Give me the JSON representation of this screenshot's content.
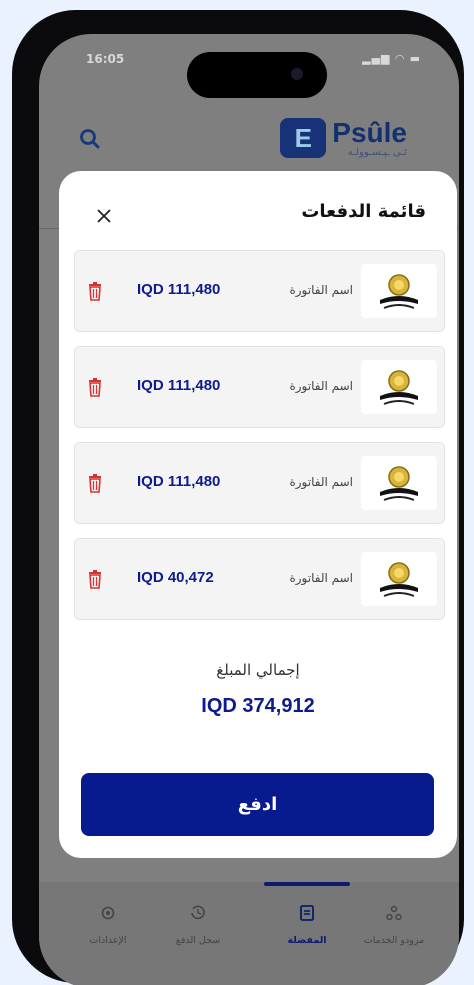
{
  "status_bar": {
    "time": "16:05",
    "icons": "signal-wifi-battery"
  },
  "header": {
    "logo_name": "Psûle",
    "logo_subtitle": "ئـی ـپـسـوولـه"
  },
  "modal": {
    "title": "قائمة الدفعات",
    "items": [
      {
        "name": "اسم الفاتورة",
        "amount": "IQD 111,480"
      },
      {
        "name": "اسم الفاتورة",
        "amount": "IQD 111,480"
      },
      {
        "name": "اسم الفاتورة",
        "amount": "IQD 111,480"
      },
      {
        "name": "اسم الفاتورة",
        "amount": "IQD 40,472"
      }
    ],
    "total_label": "إجمالي المبلغ",
    "total_amount": "IQD 374,912",
    "pay_label": "ادفع"
  },
  "tabs": [
    {
      "label": "الإعدادات",
      "icon": "settings-icon"
    },
    {
      "label": "سجل الدفع",
      "icon": "history-icon"
    },
    {
      "label": "المفضلة",
      "icon": "favorites-icon",
      "active": true
    },
    {
      "label": "مزودو الخدمات",
      "icon": "providers-icon"
    }
  ],
  "colors": {
    "accent": "#071a8e",
    "amount_text": "#0d1b8c",
    "trash": "#d93030"
  }
}
